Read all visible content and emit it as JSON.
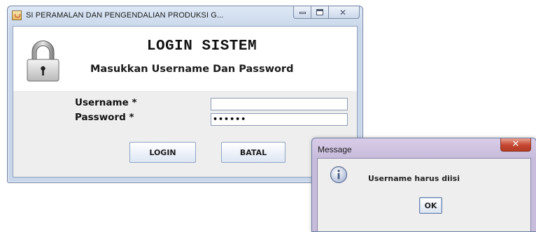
{
  "main_window": {
    "title": "SI PERAMALAN DAN PENGENDALIAN PRODUKSI G...",
    "heading": "LOGIN SISTEM",
    "subheading": "Masukkan Username Dan Password",
    "username_label": "Username *",
    "username_value": "",
    "password_label": "Password *",
    "password_value": "••••••",
    "login_button": "LOGIN",
    "cancel_button": "BATAL",
    "icons": [
      "java-app-icon",
      "minimize-icon",
      "maximize-icon",
      "close-icon",
      "padlock-icon"
    ]
  },
  "message_dialog": {
    "title": "Message",
    "message": "Username harus diisi",
    "ok_button": "OK",
    "icons": [
      "information-icon",
      "close-icon"
    ]
  }
}
